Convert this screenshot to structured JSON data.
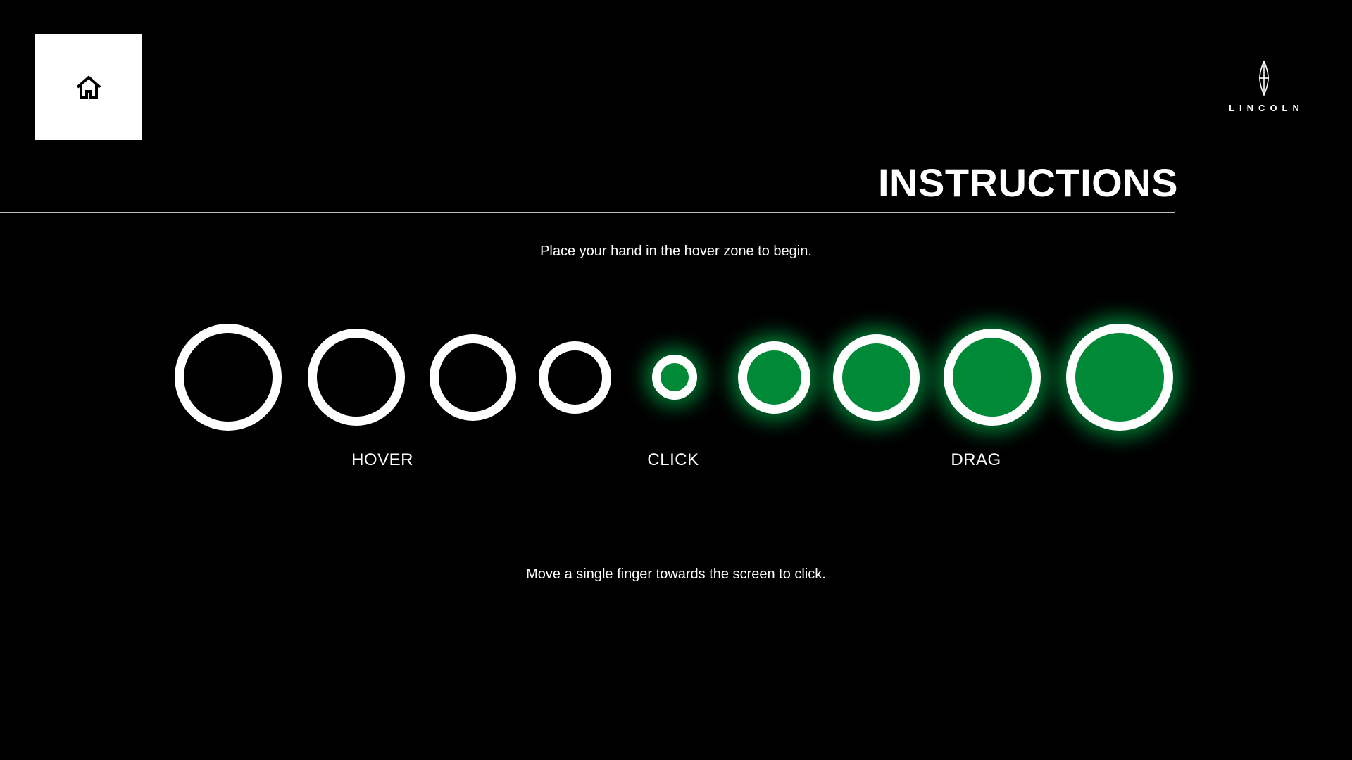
{
  "header": {
    "home_icon": "home-icon",
    "brand_icon": "lincoln-star-icon",
    "brand_name": "LINCOLN"
  },
  "title": "INSTRUCTIONS",
  "intro_text": "Place your hand in the hover zone to begin.",
  "gesture_steps": [
    {
      "label": "HOVER"
    },
    {
      "label": "CLICK"
    },
    {
      "label": "DRAG"
    }
  ],
  "footer_text": "Move a single finger towards the screen to click.",
  "colors": {
    "background": "#000000",
    "ring": "#ffffff",
    "active_fill": "#008a38",
    "active_glow": "#00a046"
  }
}
